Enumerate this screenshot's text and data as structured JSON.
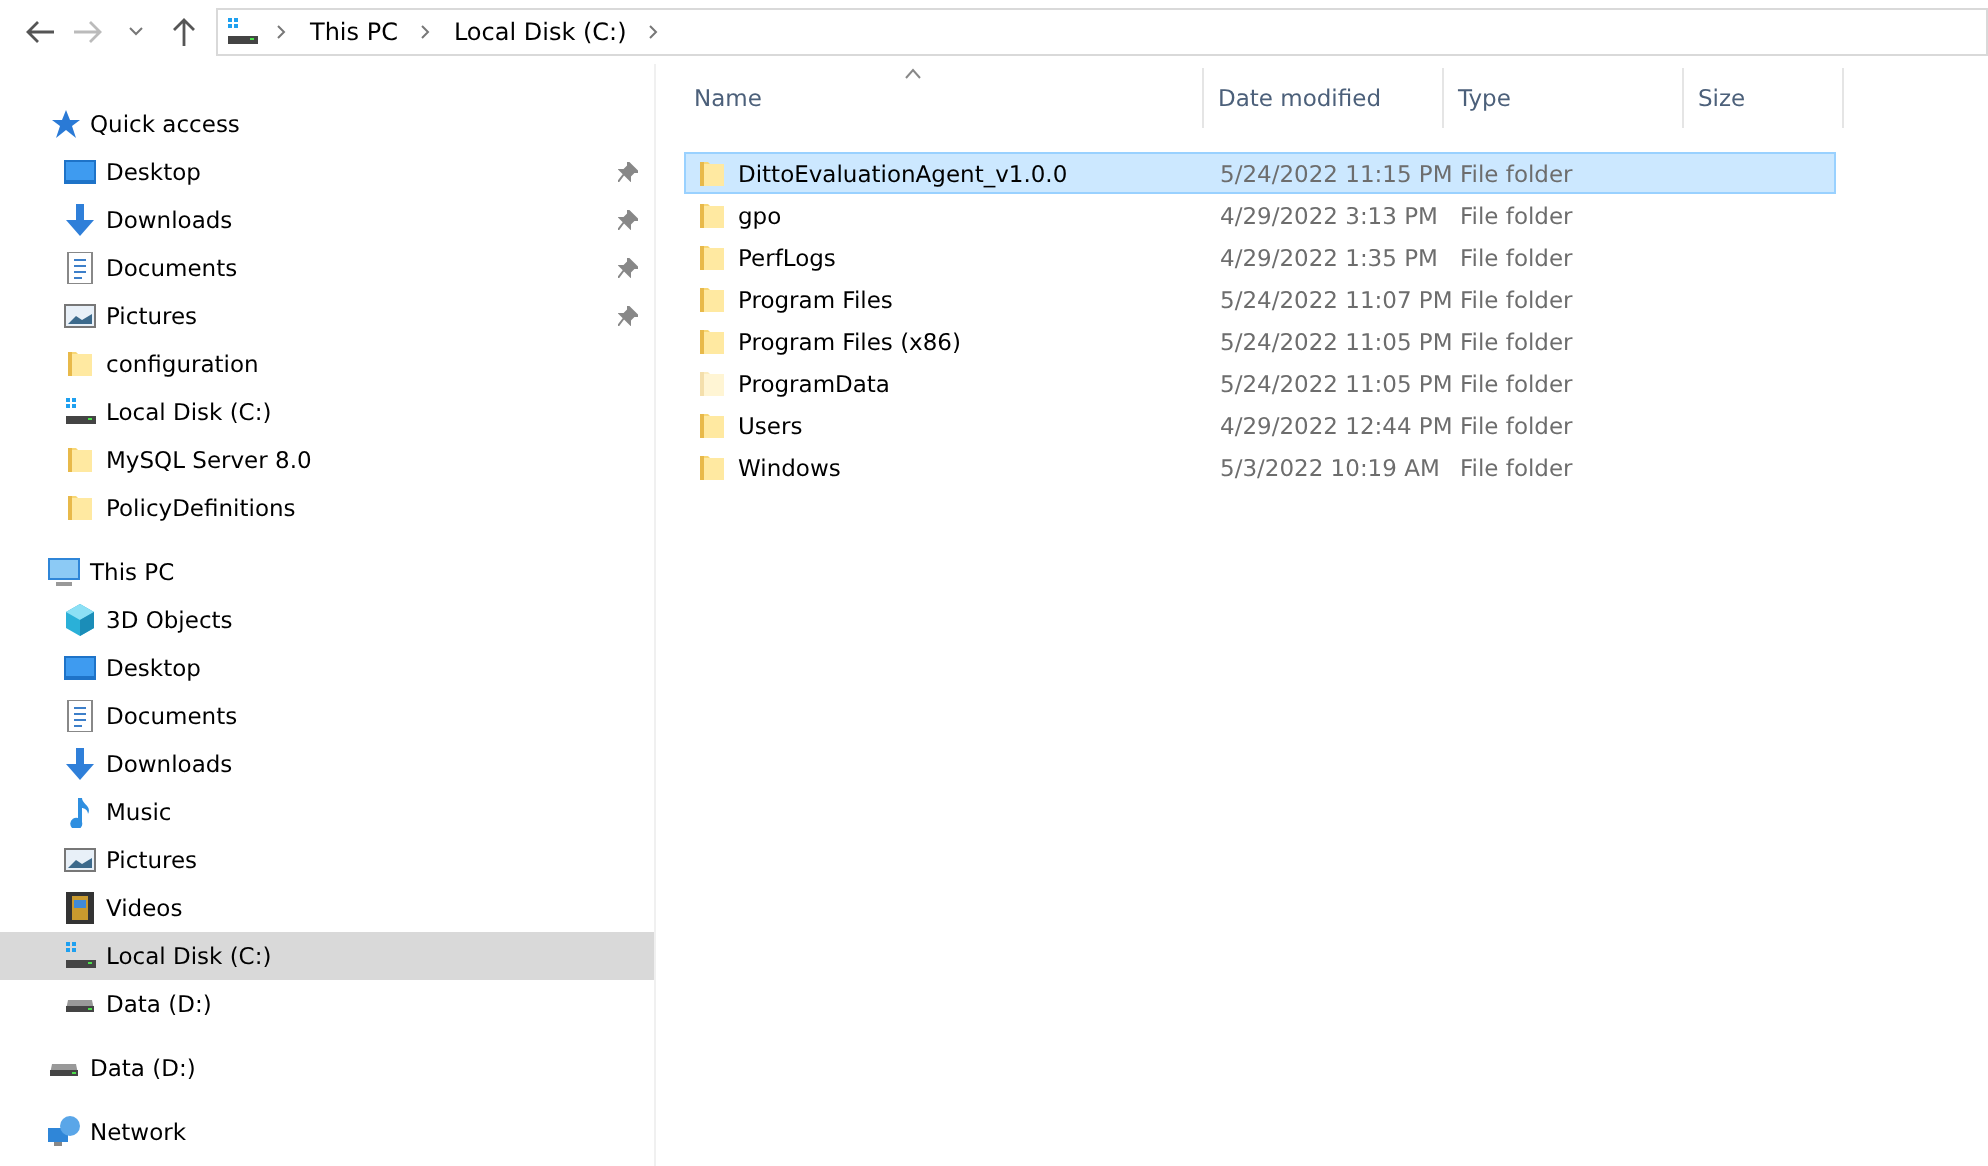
{
  "address_bar": {
    "crumbs": [
      "This PC",
      "Local Disk (C:)"
    ]
  },
  "sidebar": {
    "sections": [
      {
        "label": "Quick access",
        "kind": "star",
        "selected": false,
        "children": [
          {
            "label": "Desktop",
            "kind": "desktop",
            "pinned": true,
            "selected": false
          },
          {
            "label": "Downloads",
            "kind": "download",
            "pinned": true,
            "selected": false
          },
          {
            "label": "Documents",
            "kind": "documents",
            "pinned": true,
            "selected": false
          },
          {
            "label": "Pictures",
            "kind": "pictures",
            "pinned": true,
            "selected": false
          },
          {
            "label": "configuration",
            "kind": "folder",
            "pinned": false,
            "selected": false
          },
          {
            "label": "Local Disk (C:)",
            "kind": "sysdrive",
            "pinned": false,
            "selected": false
          },
          {
            "label": "MySQL Server 8.0",
            "kind": "folder",
            "pinned": false,
            "selected": false
          },
          {
            "label": "PolicyDefinitions",
            "kind": "folder",
            "pinned": false,
            "selected": false
          }
        ]
      },
      {
        "label": "This PC",
        "kind": "pc",
        "selected": false,
        "children": [
          {
            "label": "3D Objects",
            "kind": "cube",
            "pinned": false,
            "selected": false
          },
          {
            "label": "Desktop",
            "kind": "desktop",
            "pinned": false,
            "selected": false
          },
          {
            "label": "Documents",
            "kind": "documents",
            "pinned": false,
            "selected": false
          },
          {
            "label": "Downloads",
            "kind": "download",
            "pinned": false,
            "selected": false
          },
          {
            "label": "Music",
            "kind": "music",
            "pinned": false,
            "selected": false
          },
          {
            "label": "Pictures",
            "kind": "pictures",
            "pinned": false,
            "selected": false
          },
          {
            "label": "Videos",
            "kind": "videos",
            "pinned": false,
            "selected": false
          },
          {
            "label": "Local Disk (C:)",
            "kind": "sysdrive",
            "pinned": false,
            "selected": true
          },
          {
            "label": "Data (D:)",
            "kind": "drive",
            "pinned": false,
            "selected": false
          }
        ]
      },
      {
        "label": "Data (D:)",
        "kind": "drive",
        "selected": false
      },
      {
        "label": "Network",
        "kind": "network",
        "selected": false
      }
    ]
  },
  "table": {
    "columns": [
      "Name",
      "Date modified",
      "Type",
      "Size"
    ],
    "rows": [
      {
        "name": "DittoEvaluationAgent_v1.0.0",
        "date": "5/24/2022 11:15 PM",
        "type": "File folder",
        "selected": true,
        "hidden": false
      },
      {
        "name": "gpo",
        "date": "4/29/2022 3:13 PM",
        "type": "File folder",
        "selected": false,
        "hidden": false
      },
      {
        "name": "PerfLogs",
        "date": "4/29/2022 1:35 PM",
        "type": "File folder",
        "selected": false,
        "hidden": false
      },
      {
        "name": "Program Files",
        "date": "5/24/2022 11:07 PM",
        "type": "File folder",
        "selected": false,
        "hidden": false
      },
      {
        "name": "Program Files (x86)",
        "date": "5/24/2022 11:05 PM",
        "type": "File folder",
        "selected": false,
        "hidden": false
      },
      {
        "name": "ProgramData",
        "date": "5/24/2022 11:05 PM",
        "type": "File folder",
        "selected": false,
        "hidden": true
      },
      {
        "name": "Users",
        "date": "4/29/2022 12:44 PM",
        "type": "File folder",
        "selected": false,
        "hidden": false
      },
      {
        "name": "Windows",
        "date": "5/3/2022 10:19 AM",
        "type": "File folder",
        "selected": false,
        "hidden": false
      }
    ]
  }
}
